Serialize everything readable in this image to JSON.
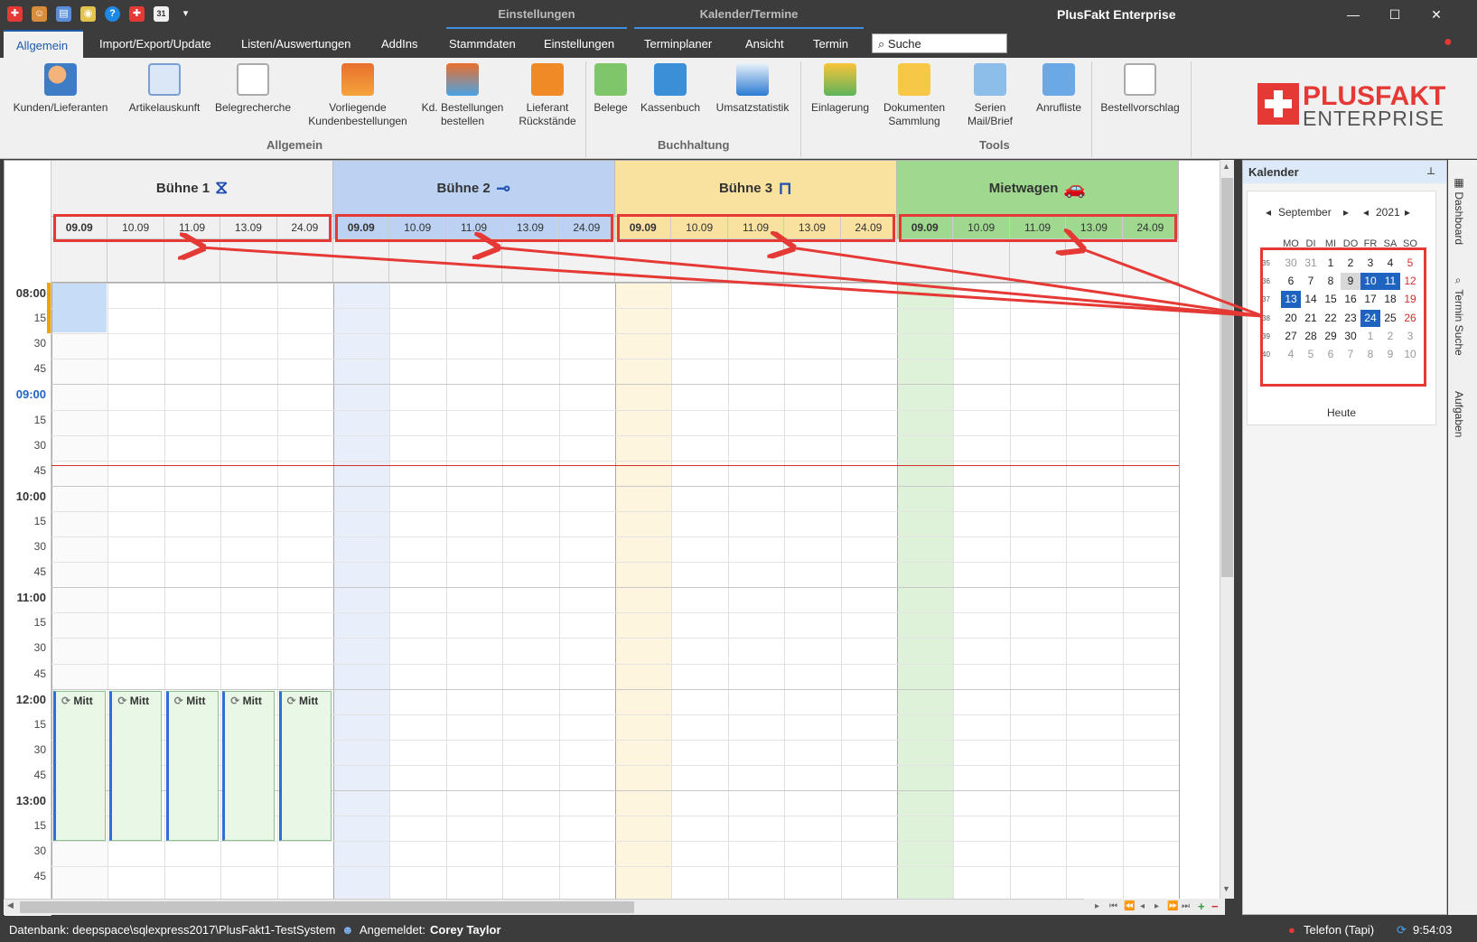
{
  "title_bar": {
    "context_tabs": [
      "Einstellungen",
      "Kalender/Termine"
    ],
    "app_title": "PlusFakt Enterprise",
    "window_buttons": [
      "minimize",
      "maximize",
      "close"
    ]
  },
  "menu": {
    "tabs": [
      "Allgemein",
      "Import/Export/Update",
      "Listen/Auswertungen",
      "AddIns",
      "Stammdaten",
      "Einstellungen",
      "Terminplaner",
      "Ansicht",
      "Termin"
    ],
    "active_tab": "Allgemein",
    "search_placeholder": "Suche"
  },
  "ribbon": {
    "groups": [
      {
        "label": "Allgemein",
        "buttons": [
          {
            "label": "Kunden/Lieferanten",
            "icon": "customers-icon"
          },
          {
            "label": "Artikelauskunft",
            "icon": "article-info-icon"
          },
          {
            "label": "Belegrecherche",
            "icon": "document-search-icon"
          },
          {
            "label": "Vorliegende Kundenbestellungen",
            "icon": "cart-icon"
          },
          {
            "label": "Kd. Bestellungen bestellen",
            "icon": "cart-add-icon"
          },
          {
            "label": "Lieferant Rückstände",
            "icon": "supplier-backlog-icon"
          }
        ]
      },
      {
        "label": "Buchhaltung",
        "buttons": [
          {
            "label": "Belege",
            "icon": "receipts-icon"
          },
          {
            "label": "Kassenbuch",
            "icon": "cash-register-icon"
          },
          {
            "label": "Umsatzstatistik",
            "icon": "sales-chart-icon"
          }
        ]
      },
      {
        "label": "Tools",
        "buttons": [
          {
            "label": "Einlagerung",
            "icon": "storage-icon"
          },
          {
            "label": "Dokumenten Sammlung",
            "icon": "folder-icon"
          },
          {
            "label": "Serien Mail/Brief",
            "icon": "mail-icon"
          },
          {
            "label": "Anrufliste",
            "icon": "call-list-icon"
          }
        ]
      },
      {
        "label": "",
        "buttons": [
          {
            "label": "Bestellvorschlag",
            "icon": "order-suggestion-icon"
          }
        ]
      }
    ],
    "logo_text_1": "PLUSFAKT",
    "logo_text_2": "ENTERPRISE"
  },
  "scheduler": {
    "resources": [
      {
        "name": "Bühne 1",
        "color": "#f0f0f0",
        "icon": "scissor-lift-icon"
      },
      {
        "name": "Bühne 2",
        "color": "#bcd2f3",
        "icon": "floor-jack-icon"
      },
      {
        "name": "Bühne 3",
        "color": "#f9e1a0",
        "icon": "two-post-lift-icon"
      },
      {
        "name": "Mietwagen",
        "color": "#9fd98f",
        "icon": "car-icon"
      }
    ],
    "dates": [
      "09.09",
      "10.09",
      "11.09",
      "13.09",
      "24.09"
    ],
    "time_labels": [
      "08:00",
      "15",
      "30",
      "45",
      "09:00",
      "15",
      "30",
      "45",
      "10:00",
      "15",
      "30",
      "45",
      "11:00",
      "15",
      "30",
      "45",
      "12:00",
      "15",
      "30",
      "45",
      "13:00",
      "15",
      "30",
      "45"
    ],
    "appointment_label": "Mitt",
    "appointment_icon": "recurring-icon"
  },
  "calendar_panel": {
    "title": "Kalender",
    "month": "September",
    "year": "2021",
    "weekdays": [
      "MO",
      "DI",
      "MI",
      "DO",
      "FR",
      "SA",
      "SO"
    ],
    "weeks": [
      {
        "wk": "35",
        "days": [
          "30",
          "31",
          "1",
          "2",
          "3",
          "4",
          "5"
        ]
      },
      {
        "wk": "36",
        "days": [
          "6",
          "7",
          "8",
          "9",
          "10",
          "11",
          "12"
        ]
      },
      {
        "wk": "37",
        "days": [
          "13",
          "14",
          "15",
          "16",
          "17",
          "18",
          "19"
        ]
      },
      {
        "wk": "38",
        "days": [
          "20",
          "21",
          "22",
          "23",
          "24",
          "25",
          "26"
        ]
      },
      {
        "wk": "39",
        "days": [
          "27",
          "28",
          "29",
          "30",
          "1",
          "2",
          "3"
        ]
      },
      {
        "wk": "40",
        "days": [
          "4",
          "5",
          "6",
          "7",
          "8",
          "9",
          "10"
        ]
      }
    ],
    "today_button": "Heute"
  },
  "side_tabs": [
    "Dashboard",
    "Termin Suche",
    "Aufgaben"
  ],
  "status_bar": {
    "database": "Datenbank: deepspace\\sqlexpress2017\\PlusFakt1-TestSystem",
    "logged_in_label": "Angemeldet:",
    "user": "Corey Taylor",
    "phone": "Telefon (Tapi)",
    "time": "9:54:03"
  }
}
